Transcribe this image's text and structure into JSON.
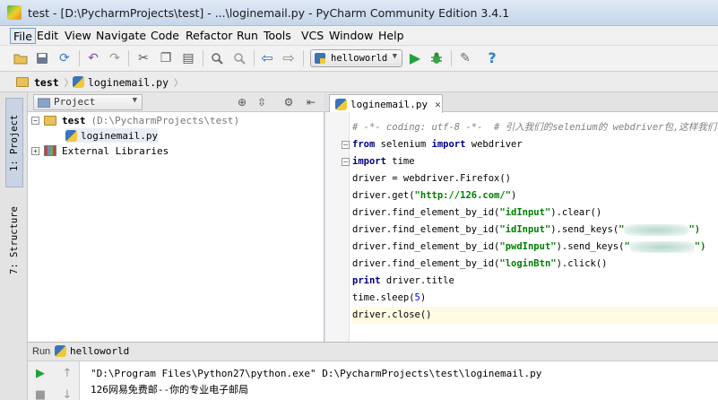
{
  "window": {
    "title": "test - [D:\\PycharmProjects\\test] - ...\\loginemail.py - PyCharm Community Edition 3.4.1"
  },
  "menu": [
    "File",
    "Edit",
    "View",
    "Navigate",
    "Code",
    "Refactor",
    "Run",
    "Tools",
    "VCS",
    "Window",
    "Help"
  ],
  "toolbar": {
    "run_config": "helloworld",
    "icons": [
      "open-folder-icon",
      "save-icon",
      "sync-icon",
      "undo-icon",
      "redo-icon",
      "cut-icon",
      "copy-icon",
      "paste-icon",
      "find-icon",
      "replace-icon",
      "back-icon",
      "forward-icon",
      "run-icon",
      "debug-icon",
      "settings-icon",
      "help-icon"
    ]
  },
  "navbar": {
    "project": "test",
    "file": "loginemail.py"
  },
  "side_tabs": {
    "project": "1: Project",
    "structure": "7: Structure"
  },
  "project_panel": {
    "view_label": "Project",
    "root_name": "test",
    "root_path": "(D:\\PycharmProjects\\test)",
    "file": "loginemail.py",
    "external": "External Libraries"
  },
  "editor": {
    "tab_label": "loginemail.py",
    "lines": [
      {
        "comment": "# -*- coding: utf-8 -*-  # 引入我们的selenium的 webdriver包,这样我们"
      },
      {
        "kw1": "from",
        "mid": " selenium ",
        "kw2": "import",
        "rest": " webdriver"
      },
      {
        "kw1": "import",
        "rest": " time"
      },
      {
        "text": "driver = webdriver.Firefox()"
      },
      {
        "pre": "driver.get(",
        "str": "\"http://126.com/\"",
        "post": ")"
      },
      {
        "pre": "driver.find_element_by_id(",
        "str": "\"idInput\"",
        "post": ").clear()"
      },
      {
        "pre": "driver.find_element_by_id(",
        "str": "\"idInput\"",
        "post": ").send_keys(",
        "str2": "\"",
        "post2": "\")"
      },
      {
        "pre": "driver.find_element_by_id(",
        "str": "\"pwdInput\"",
        "post": ").send_keys(",
        "str2": "\"",
        "post2": "\")"
      },
      {
        "pre": "driver.find_element_by_id(",
        "str": "\"loginBtn\"",
        "post": ").click()"
      },
      {
        "kw1": "print",
        "rest": " driver.title"
      },
      {
        "pre": "time.sleep(",
        "num": "5",
        "post": ")"
      },
      {
        "text": "driver.close()"
      }
    ]
  },
  "run_panel": {
    "title": "Run",
    "tab": "helloworld",
    "console": [
      "\"D:\\Program Files\\Python27\\python.exe\" D:\\PycharmProjects\\test\\loginemail.py",
      "126网易免费邮--你的专业电子邮局"
    ]
  }
}
